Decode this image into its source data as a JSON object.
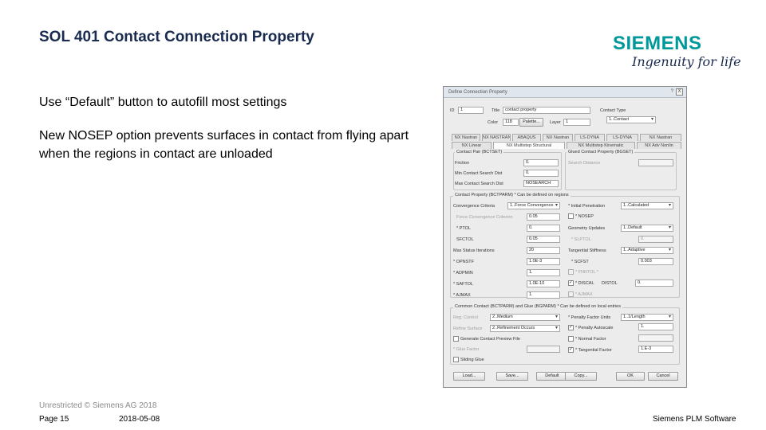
{
  "slide": {
    "title": "SOL 401 Contact Connection Property",
    "logo": {
      "brand": "SIEMENS",
      "tagline": "Ingenuity for life",
      "brand_color": "#009999"
    },
    "bullets": [
      "Use “Default” button to autofill most settings",
      "New NOSEP option prevents surfaces in contact from flying apart when the regions in contact are unloaded"
    ],
    "footer": {
      "classification": "Unrestricted © Siemens AG 2018",
      "page": "Page 15",
      "date": "2018-05-08",
      "company": "Siemens PLM Software"
    }
  },
  "dialog": {
    "title": "Define Connection Property",
    "help": "?",
    "close": "X",
    "id_label": "ID",
    "id_value": "1",
    "title_label": "Title",
    "title_value": "contact property",
    "color_label": "Color",
    "color_value": "118",
    "palette_label": "Palette...",
    "layer_label": "Layer",
    "layer_value": "1",
    "contact_type_label": "Contact Type",
    "contact_type_value": "1..Contact",
    "tabs_row1": [
      "NX Nastran",
      "NX NASTRAN",
      "ABAQUS",
      "NX Nastran",
      "LS-DYNA",
      "LS-DYNA",
      "NX Nastran"
    ],
    "tabs_row2": [
      "NX Linear",
      "NX Multistep Structural",
      "NX Multistep Kinematic",
      "NX Adv Nonlin"
    ],
    "contact_pair": {
      "header": "Contact Pair (BCTSET)",
      "fields": [
        {
          "label": "Friction",
          "value": "0."
        },
        {
          "label": "Min Contact Search Dist",
          "value": "0."
        },
        {
          "label": "Max Contact Search Dist",
          "value": "NOSEARCH"
        }
      ]
    },
    "glued": {
      "header": "Glued Contact Property (BGSET)",
      "fields": [
        {
          "label": "Search Distance",
          "value": ""
        }
      ]
    },
    "contact_property": {
      "header": "Contact Property (BCTPARM) * Can be defined on regions",
      "left": [
        {
          "label": "Convergence Criteria",
          "value": "1..Force Convergence"
        },
        {
          "label": "Force Convergence Criterion",
          "value": "0.05"
        },
        {
          "label": "* PTOL",
          "value": "0."
        },
        {
          "label": "SFCTOL",
          "value": "0.05"
        },
        {
          "label": "Max Status Iterations",
          "value": "20"
        },
        {
          "label": "* OPNSTF",
          "value": "1.0E-3"
        },
        {
          "label": "* ADPMIN",
          "value": "1."
        },
        {
          "label": "* SAFTOL",
          "value": "1.0E-10"
        },
        {
          "label": "* AJMAX",
          "value": "1."
        }
      ],
      "right": [
        {
          "label": "* Initial Penetration",
          "value": "1..Calculated"
        },
        {
          "label": "* NOSEP",
          "value": ""
        },
        {
          "label": "Geometry Updates",
          "value": "1..Default"
        },
        {
          "label": "* SLPTOL",
          "value": "0."
        },
        {
          "label": "Tangential Stiffness",
          "value": "1..Adaptive"
        },
        {
          "label": "* SCFST",
          "value": "0.003"
        },
        {
          "label": "* FNRTOL *",
          "value": ""
        },
        {
          "label": "* DISCAL",
          "value": ""
        },
        {
          "label": "DISTOL",
          "value": "0."
        },
        {
          "label": "* AJMAX",
          "value": ""
        }
      ]
    },
    "common": {
      "header": "Common Contact (BCTPARM) and Glue (BGPARM) * Can be defined on local entries",
      "left": [
        {
          "label": "Reg. Control",
          "value": "2..Medium"
        },
        {
          "label": "Refine Surface",
          "value": "2..Refinement Occurs"
        },
        {
          "label": "Generate Contact Preview File",
          "value": ""
        },
        {
          "label": "* Glue Factor",
          "value": ""
        },
        {
          "label": "Sliding Glue",
          "value": ""
        }
      ],
      "right": [
        {
          "label": "* Penalty Factor Units",
          "value": "1..1/Length"
        },
        {
          "label": "* Penalty Autoscale",
          "value": "1."
        },
        {
          "label": "* Normal Factor",
          "value": ""
        },
        {
          "label": "* Tangential Factor",
          "value": "1.E-3"
        }
      ]
    },
    "buttons": [
      "Load...",
      "Save...",
      "Default",
      "Copy...",
      "OK",
      "Cancel"
    ]
  }
}
